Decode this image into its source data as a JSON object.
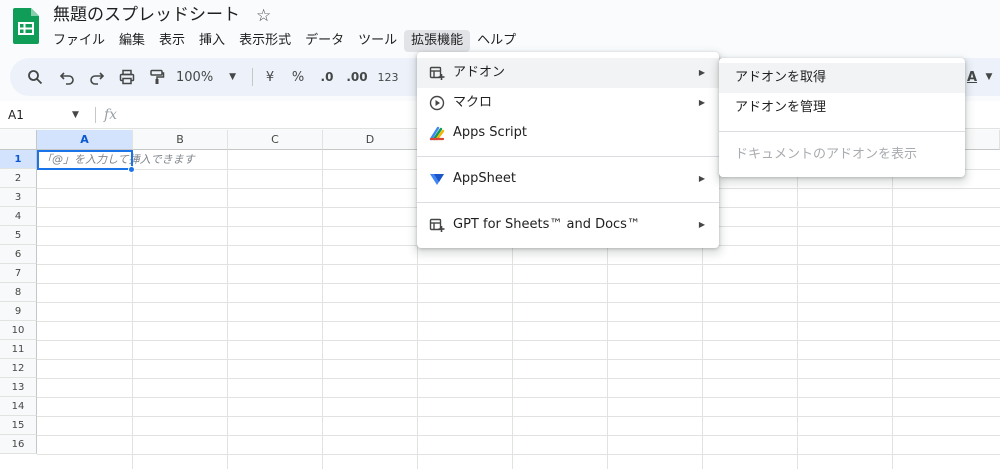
{
  "title_bar": {
    "doc_title": "無題のスプレッドシート",
    "star_glyph": "☆",
    "logo_color": "#0f9d58"
  },
  "menubar": {
    "items": [
      "ファイル",
      "編集",
      "表示",
      "挿入",
      "表示形式",
      "データ",
      "ツール",
      "拡張機能",
      "ヘルプ"
    ],
    "active_index": 7
  },
  "toolbar": {
    "zoom": "100%",
    "currency": "¥",
    "percent": "%",
    "decrease_decimal": ".0",
    "increase_decimal": ".00",
    "number_format": "123",
    "text_color": "A"
  },
  "formula_bar": {
    "cell_ref": "A1",
    "fx": "fx"
  },
  "grid": {
    "columns": [
      "A",
      "B",
      "C",
      "D"
    ],
    "rows": [
      "1",
      "2",
      "3",
      "4",
      "5",
      "6",
      "7",
      "8",
      "9",
      "10",
      "11",
      "12",
      "13",
      "14",
      "15",
      "16"
    ],
    "selected_cell": "A1",
    "cell_hint": "「@」を入力して挿入できます"
  },
  "extensions_menu": {
    "items": [
      {
        "label": "アドオン",
        "icon": "addon-icon",
        "has_submenu": true
      },
      {
        "label": "マクロ",
        "icon": "macro-play-icon",
        "has_submenu": true
      },
      {
        "label": "Apps Script",
        "icon": "apps-script-icon",
        "has_submenu": false
      },
      {
        "label": "AppSheet",
        "icon": "appsheet-icon",
        "has_submenu": true
      },
      {
        "label": "GPT for Sheets™ and Docs™",
        "icon": "addon-icon",
        "has_submenu": true
      }
    ],
    "arrow_glyph": "▶"
  },
  "addons_submenu": {
    "items": [
      {
        "label": "アドオンを取得",
        "disabled": false
      },
      {
        "label": "アドオンを管理",
        "disabled": false
      },
      {
        "label": "ドキュメントのアドオンを表示",
        "disabled": true
      }
    ]
  },
  "colors": {
    "accent": "#1a73e8",
    "toolbar_bg": "#edf2fa",
    "appsheet_blue": "#4285f4"
  }
}
